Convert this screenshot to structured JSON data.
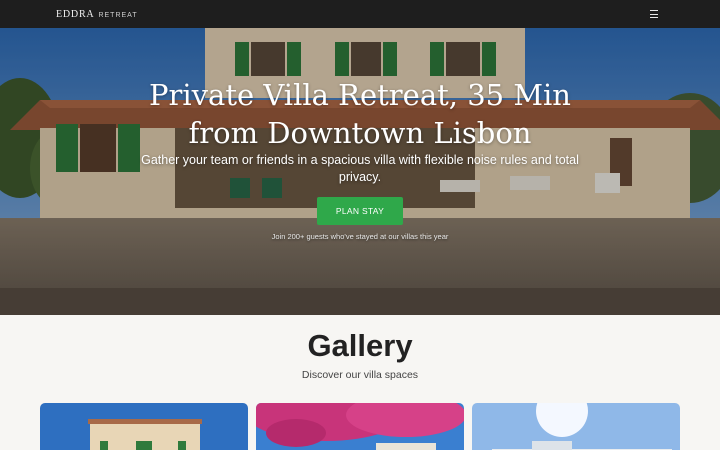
{
  "header": {
    "brand_name": "EDDRA",
    "brand_sub": "RETREAT",
    "menu_icon": "menu-icon"
  },
  "hero": {
    "title": "Private Villa Retreat, 35 Min from Downtown Lisbon",
    "subtitle": "Gather your team or friends in a spacious villa with flexible noise rules and total privacy.",
    "cta_label": "PLAN STAY",
    "note": "Join 200+ guests who've stayed at our villas this year",
    "cta_color": "#2fa84a"
  },
  "gallery": {
    "title": "Gallery",
    "subtitle": "Discover our villa spaces"
  }
}
